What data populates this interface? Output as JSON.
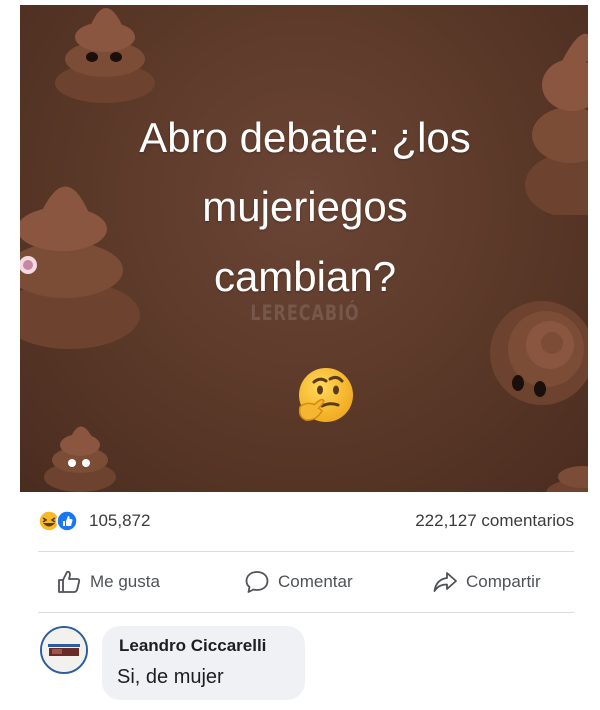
{
  "post": {
    "headline_lines": [
      "Abro debate: ¿los",
      "mujeriegos",
      "cambian?"
    ],
    "watermark": "LERECABIÓ",
    "background_color": "#5a3828"
  },
  "stats": {
    "reaction_count": "105,872",
    "comment_count": "222,127 comentarios"
  },
  "actions": {
    "like_label": "Me gusta",
    "comment_label": "Comentar",
    "share_label": "Compartir"
  },
  "comment": {
    "author": "Leandro Ciccarelli",
    "text": "Si, de mujer"
  },
  "icons": {
    "reactions": [
      "haha-reaction-icon",
      "like-reaction-icon"
    ],
    "like": "thumbs-up-icon",
    "comment": "speech-bubble-icon",
    "share": "share-arrow-icon",
    "emoji": "thinking-face-icon",
    "decoration": "poop-emoji-icon"
  },
  "colors": {
    "like_blue": "#1877f2",
    "haha_yellow": "#f7b928",
    "text_muted": "#4f5256",
    "bubble_bg": "#eff1f4"
  }
}
